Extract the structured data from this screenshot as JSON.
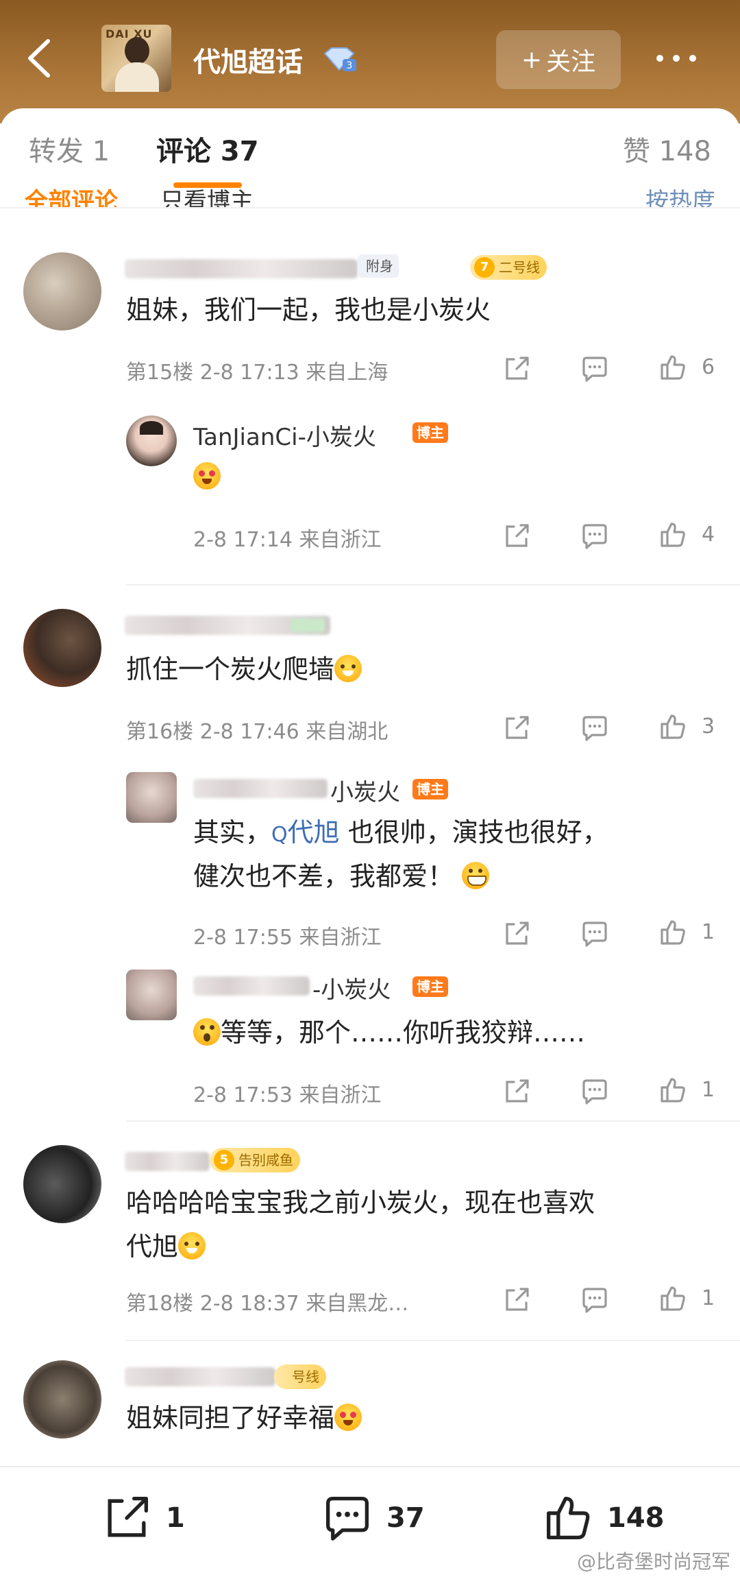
{
  "header": {
    "channel_title": "代旭超话",
    "follow_label": "关注",
    "avatar_text": "DAI XU"
  },
  "tabs": {
    "repost": "转发 1",
    "comments": "评论 37",
    "likes": "赞 148"
  },
  "subtabs": {
    "all": "全部评论",
    "host_only": "只看博主",
    "sort": "按热度"
  },
  "comments": [
    {
      "tag_attach": "附身",
      "fan_level": "7",
      "fan_tag": "二号线",
      "text": "姐妹，我们一起，我也是小炭火",
      "floor": "第15楼",
      "time": "2-8 17:13",
      "location": "来自上海",
      "likes": "6",
      "replies": [
        {
          "name": "TanJianCi-小炭火",
          "badge": "博主",
          "time": "2-8 17:14",
          "location": "来自浙江",
          "likes": "4"
        }
      ]
    },
    {
      "text": "抓住一个炭火爬墙",
      "floor": "第16楼",
      "time": "2-8 17:46",
      "location": "来自湖北",
      "likes": "3",
      "replies": [
        {
          "name_suffix": "小炭火",
          "badge": "博主",
          "text_pre": "其实，",
          "topic": "代旭",
          "text_post": " 也很帅，演技也很好，",
          "text_line2": "健次也不差，我都爱！",
          "time": "2-8 17:55",
          "location": "来自浙江",
          "likes": "1"
        },
        {
          "name_suffix": "-小炭火",
          "badge": "博主",
          "text": "等等，那个……你听我狡辩……",
          "time": "2-8 17:53",
          "location": "来自浙江",
          "likes": "1"
        }
      ]
    },
    {
      "fan_level": "5",
      "fan_tag": "告别咸鱼",
      "text_line1": "哈哈哈哈宝宝我之前小炭火，现在也喜欢",
      "text_line2": "代旭",
      "floor": "第18楼",
      "time": "2-8 18:37",
      "location": "来自黑龙…",
      "likes": "1"
    },
    {
      "fan_tag": "号线",
      "text": "姐妹同担了好幸福"
    }
  ],
  "bottom_bar": {
    "repost_count": "1",
    "comment_count": "37",
    "like_count": "148"
  },
  "watermark": "@比奇堡时尚冠军"
}
